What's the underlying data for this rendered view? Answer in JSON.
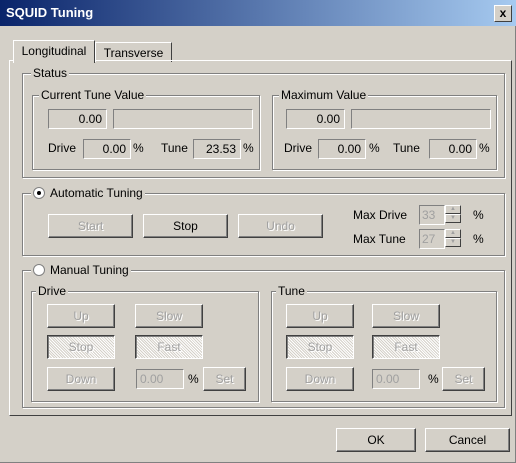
{
  "window": {
    "title": "SQUID Tuning",
    "close_glyph": "x"
  },
  "tabs": [
    {
      "label": "Longitudinal"
    },
    {
      "label": "Transverse"
    }
  ],
  "status": {
    "label": "Status",
    "current": {
      "label": "Current Tune Value",
      "value": "0.00",
      "drive_label": "Drive",
      "drive_value": "0.00",
      "drive_unit": "%",
      "tune_label": "Tune",
      "tune_value": "23.53",
      "tune_unit": "%"
    },
    "maximum": {
      "label": "Maximum Value",
      "value": "0.00",
      "drive_label": "Drive",
      "drive_value": "0.00",
      "drive_unit": "%",
      "tune_label": "Tune",
      "tune_value": "0.00",
      "tune_unit": "%"
    }
  },
  "auto": {
    "label": "Automatic Tuning",
    "selected": true,
    "start": "Start",
    "stop": "Stop",
    "undo": "Undo",
    "max_drive_label": "Max Drive",
    "max_drive_value": "33",
    "max_drive_unit": "%",
    "max_tune_label": "Max Tune",
    "max_tune_value": "27",
    "max_tune_unit": "%"
  },
  "manual": {
    "label": "Manual Tuning",
    "selected": false,
    "drive": {
      "label": "Drive",
      "up": "Up",
      "slow": "Slow",
      "stop": "Stop",
      "fast": "Fast",
      "down": "Down",
      "value": "0.00",
      "unit": "%",
      "set": "Set"
    },
    "tune": {
      "label": "Tune",
      "up": "Up",
      "slow": "Slow",
      "stop": "Stop",
      "fast": "Fast",
      "down": "Down",
      "value": "0.00",
      "unit": "%",
      "set": "Set"
    }
  },
  "footer": {
    "ok": "OK",
    "cancel": "Cancel"
  }
}
